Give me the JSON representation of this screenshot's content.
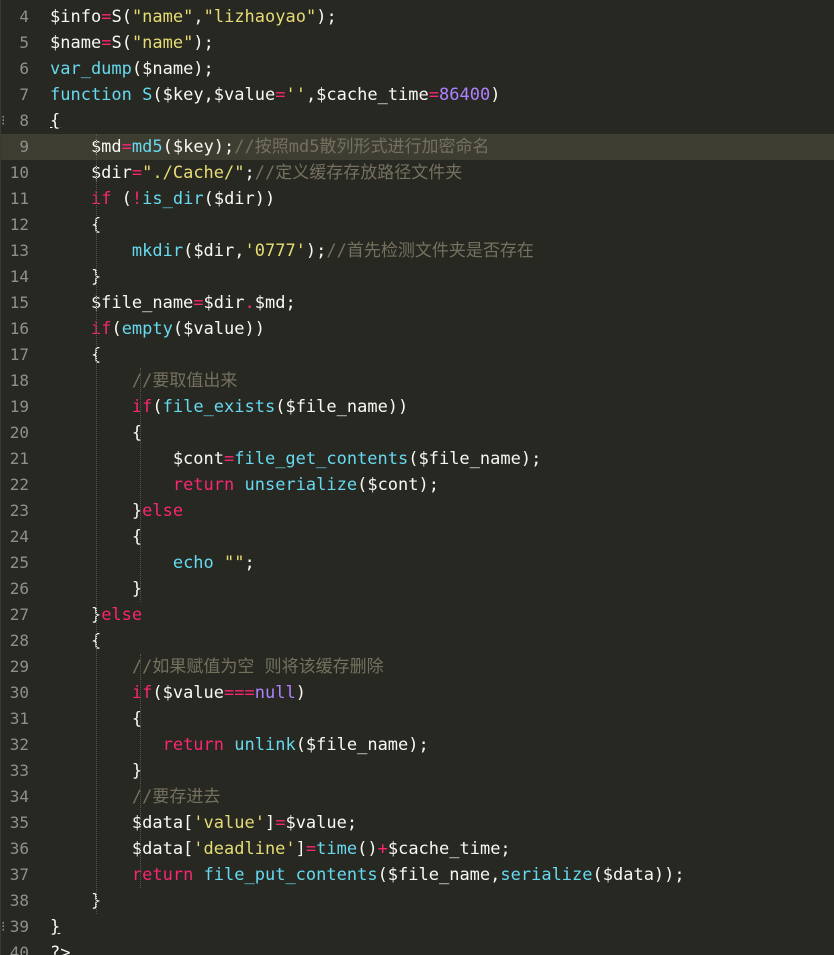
{
  "editor": {
    "lines": [
      {
        "n": "4",
        "tokens": [
          {
            "t": "$info",
            "c": "var"
          },
          {
            "t": "=",
            "c": "op"
          },
          {
            "t": "S",
            "c": "plain"
          },
          {
            "t": "(",
            "c": "plain"
          },
          {
            "t": "\"name\"",
            "c": "str"
          },
          {
            "t": ",",
            "c": "plain"
          },
          {
            "t": "\"lizhaoyao\"",
            "c": "str"
          },
          {
            "t": ");",
            "c": "plain"
          }
        ]
      },
      {
        "n": "5",
        "tokens": [
          {
            "t": "$name",
            "c": "var"
          },
          {
            "t": "=",
            "c": "op"
          },
          {
            "t": "S",
            "c": "plain"
          },
          {
            "t": "(",
            "c": "plain"
          },
          {
            "t": "\"name\"",
            "c": "str"
          },
          {
            "t": ");",
            "c": "plain"
          }
        ]
      },
      {
        "n": "6",
        "tokens": [
          {
            "t": "var_dump",
            "c": "fn"
          },
          {
            "t": "($name);",
            "c": "plain"
          }
        ]
      },
      {
        "n": "7",
        "tokens": [
          {
            "t": "function ",
            "c": "fn"
          },
          {
            "t": "S",
            "c": "fn"
          },
          {
            "t": "($key,$value",
            "c": "plain"
          },
          {
            "t": "=",
            "c": "op"
          },
          {
            "t": "''",
            "c": "str"
          },
          {
            "t": ",$cache_time",
            "c": "plain"
          },
          {
            "t": "=",
            "c": "op"
          },
          {
            "t": "86400",
            "c": "num"
          },
          {
            "t": ")",
            "c": "plain"
          }
        ]
      },
      {
        "n": "8",
        "tokens": [
          {
            "t": "{",
            "c": "plain",
            "u": true
          }
        ]
      },
      {
        "n": "9",
        "tokens": [
          {
            "t": "    $md",
            "c": "var"
          },
          {
            "t": "=",
            "c": "op"
          },
          {
            "t": "md5",
            "c": "fn"
          },
          {
            "t": "($key);",
            "c": "plain"
          },
          {
            "t": "//按照md5散列形式进行加密命名",
            "c": "cmt"
          }
        ]
      },
      {
        "n": "10",
        "tokens": [
          {
            "t": "    $dir",
            "c": "var"
          },
          {
            "t": "=",
            "c": "op"
          },
          {
            "t": "\"./Cache/\"",
            "c": "str"
          },
          {
            "t": ";",
            "c": "plain"
          },
          {
            "t": "//定义缓存存放路径文件夹",
            "c": "cmt"
          }
        ]
      },
      {
        "n": "11",
        "tokens": [
          {
            "t": "    ",
            "c": "plain"
          },
          {
            "t": "if",
            "c": "kw"
          },
          {
            "t": " (",
            "c": "plain"
          },
          {
            "t": "!",
            "c": "op"
          },
          {
            "t": "is_dir",
            "c": "fn"
          },
          {
            "t": "($dir))",
            "c": "plain"
          }
        ]
      },
      {
        "n": "12",
        "tokens": [
          {
            "t": "    {",
            "c": "plain"
          }
        ]
      },
      {
        "n": "13",
        "tokens": [
          {
            "t": "        ",
            "c": "plain"
          },
          {
            "t": "mkdir",
            "c": "fn"
          },
          {
            "t": "($dir,",
            "c": "plain"
          },
          {
            "t": "'0777'",
            "c": "str"
          },
          {
            "t": ");",
            "c": "plain"
          },
          {
            "t": "//首先检测文件夹是否存在",
            "c": "cmt"
          }
        ]
      },
      {
        "n": "14",
        "tokens": [
          {
            "t": "    }",
            "c": "plain"
          }
        ]
      },
      {
        "n": "15",
        "tokens": [
          {
            "t": "    $file_name",
            "c": "var"
          },
          {
            "t": "=",
            "c": "op"
          },
          {
            "t": "$dir",
            "c": "plain"
          },
          {
            "t": ".",
            "c": "op"
          },
          {
            "t": "$md;",
            "c": "plain"
          }
        ]
      },
      {
        "n": "16",
        "tokens": [
          {
            "t": "    ",
            "c": "plain"
          },
          {
            "t": "if",
            "c": "kw"
          },
          {
            "t": "(",
            "c": "plain"
          },
          {
            "t": "empty",
            "c": "fn"
          },
          {
            "t": "($value))",
            "c": "plain"
          }
        ]
      },
      {
        "n": "17",
        "tokens": [
          {
            "t": "    {",
            "c": "plain"
          }
        ]
      },
      {
        "n": "18",
        "tokens": [
          {
            "t": "        ",
            "c": "plain"
          },
          {
            "t": "//要取值出来",
            "c": "cmt"
          }
        ]
      },
      {
        "n": "19",
        "tokens": [
          {
            "t": "        ",
            "c": "plain"
          },
          {
            "t": "if",
            "c": "kw"
          },
          {
            "t": "(",
            "c": "plain"
          },
          {
            "t": "file_exists",
            "c": "fn"
          },
          {
            "t": "($file_name))",
            "c": "plain"
          }
        ]
      },
      {
        "n": "20",
        "tokens": [
          {
            "t": "        {",
            "c": "plain"
          }
        ]
      },
      {
        "n": "21",
        "tokens": [
          {
            "t": "            $cont",
            "c": "var"
          },
          {
            "t": "=",
            "c": "op"
          },
          {
            "t": "file_get_contents",
            "c": "fn"
          },
          {
            "t": "($file_name);",
            "c": "plain"
          }
        ]
      },
      {
        "n": "22",
        "tokens": [
          {
            "t": "            ",
            "c": "plain"
          },
          {
            "t": "return",
            "c": "kw"
          },
          {
            "t": " ",
            "c": "plain"
          },
          {
            "t": "unserialize",
            "c": "fn"
          },
          {
            "t": "($cont);",
            "c": "plain"
          }
        ]
      },
      {
        "n": "23",
        "tokens": [
          {
            "t": "        }",
            "c": "plain"
          },
          {
            "t": "else",
            "c": "kw"
          }
        ]
      },
      {
        "n": "24",
        "tokens": [
          {
            "t": "        {",
            "c": "plain"
          }
        ]
      },
      {
        "n": "25",
        "tokens": [
          {
            "t": "            ",
            "c": "plain"
          },
          {
            "t": "echo",
            "c": "fn"
          },
          {
            "t": " ",
            "c": "plain"
          },
          {
            "t": "\"\"",
            "c": "str"
          },
          {
            "t": ";",
            "c": "plain"
          }
        ]
      },
      {
        "n": "26",
        "tokens": [
          {
            "t": "        }",
            "c": "plain"
          }
        ]
      },
      {
        "n": "27",
        "tokens": [
          {
            "t": "    }",
            "c": "plain"
          },
          {
            "t": "else",
            "c": "kw"
          }
        ]
      },
      {
        "n": "28",
        "tokens": [
          {
            "t": "    {",
            "c": "plain"
          }
        ]
      },
      {
        "n": "29",
        "tokens": [
          {
            "t": "        ",
            "c": "plain"
          },
          {
            "t": "//如果赋值为空 则将该缓存删除",
            "c": "cmt"
          }
        ]
      },
      {
        "n": "30",
        "tokens": [
          {
            "t": "        ",
            "c": "plain"
          },
          {
            "t": "if",
            "c": "kw"
          },
          {
            "t": "($value",
            "c": "plain"
          },
          {
            "t": "===",
            "c": "op"
          },
          {
            "t": "null",
            "c": "num"
          },
          {
            "t": ")",
            "c": "plain"
          }
        ]
      },
      {
        "n": "31",
        "tokens": [
          {
            "t": "        {",
            "c": "plain"
          }
        ]
      },
      {
        "n": "32",
        "tokens": [
          {
            "t": "           ",
            "c": "plain"
          },
          {
            "t": "return",
            "c": "kw"
          },
          {
            "t": " ",
            "c": "plain"
          },
          {
            "t": "unlink",
            "c": "fn"
          },
          {
            "t": "($file_name);",
            "c": "plain"
          }
        ]
      },
      {
        "n": "33",
        "tokens": [
          {
            "t": "        }",
            "c": "plain"
          }
        ]
      },
      {
        "n": "34",
        "tokens": [
          {
            "t": "        ",
            "c": "plain"
          },
          {
            "t": "//要存进去",
            "c": "cmt"
          }
        ]
      },
      {
        "n": "35",
        "tokens": [
          {
            "t": "        $data[",
            "c": "plain"
          },
          {
            "t": "'value'",
            "c": "str"
          },
          {
            "t": "]",
            "c": "plain"
          },
          {
            "t": "=",
            "c": "op"
          },
          {
            "t": "$value;",
            "c": "plain"
          }
        ]
      },
      {
        "n": "36",
        "tokens": [
          {
            "t": "        $data[",
            "c": "plain"
          },
          {
            "t": "'deadline'",
            "c": "str"
          },
          {
            "t": "]",
            "c": "plain"
          },
          {
            "t": "=",
            "c": "op"
          },
          {
            "t": "time",
            "c": "fn"
          },
          {
            "t": "()",
            "c": "plain"
          },
          {
            "t": "+",
            "c": "op"
          },
          {
            "t": "$cache_time;",
            "c": "plain"
          }
        ]
      },
      {
        "n": "37",
        "tokens": [
          {
            "t": "        ",
            "c": "plain"
          },
          {
            "t": "return",
            "c": "kw"
          },
          {
            "t": " ",
            "c": "plain"
          },
          {
            "t": "file_put_contents",
            "c": "fn"
          },
          {
            "t": "($file_name,",
            "c": "plain"
          },
          {
            "t": "serialize",
            "c": "fn"
          },
          {
            "t": "($data));",
            "c": "plain"
          }
        ]
      },
      {
        "n": "38",
        "tokens": [
          {
            "t": "    }",
            "c": "plain"
          }
        ]
      },
      {
        "n": "39",
        "tokens": [
          {
            "t": "}",
            "c": "plain",
            "u": true
          }
        ]
      },
      {
        "n": "40",
        "tokens": [
          {
            "t": "?>",
            "c": "plain"
          }
        ]
      }
    ],
    "current_line": "9",
    "fold_markers": [
      "8",
      "39"
    ]
  },
  "colors": {
    "background": "#272822",
    "current_line": "#3e3d32",
    "gutter": "#8f908a",
    "variable": "#f8f8f2",
    "operator": "#f92672",
    "string": "#e6db74",
    "function": "#66d9ef",
    "keyword": "#f92672",
    "number": "#ae81ff",
    "comment": "#75715e"
  }
}
